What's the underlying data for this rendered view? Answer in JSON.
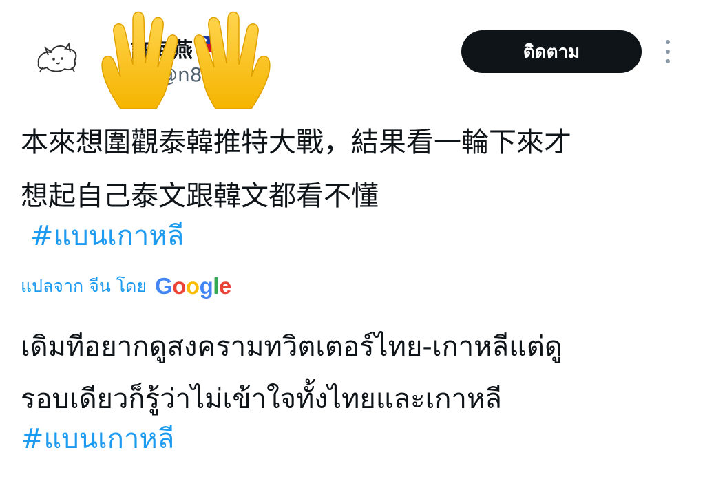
{
  "header": {
    "display_name": "許海燕",
    "handle": "@n8",
    "follow_label": "ติดตาม",
    "avatar_icon": "cat-sketch-icon",
    "flag_icon": "taiwan-flag-icon",
    "overlay_icon": "raised-hands-emoji-icon",
    "more_icon": "more-vertical-icon"
  },
  "tweet": {
    "text_line1": "本來想圍觀泰韓推特大戰，結果看一輪下來才",
    "text_line2": "想起自己泰文跟韓文都看不懂",
    "hashtag": "#แบนเกาหลี"
  },
  "translation": {
    "label": "แปลจาก จีน โดย",
    "provider": "Google",
    "text_line1": "เดิมทีอยากดูสงครามทวิตเตอร์ไทย-เกาหลีแต่ดู",
    "text_line2": "รอบเดียวก็รู้ว่าไม่เข้าใจทั้งไทยและเกาหลี",
    "hashtag": "#แบนเกาหลี"
  },
  "colors": {
    "link": "#1d9bf0",
    "button_bg": "#0f1419",
    "text": "#0f1419",
    "muted": "#536471"
  }
}
